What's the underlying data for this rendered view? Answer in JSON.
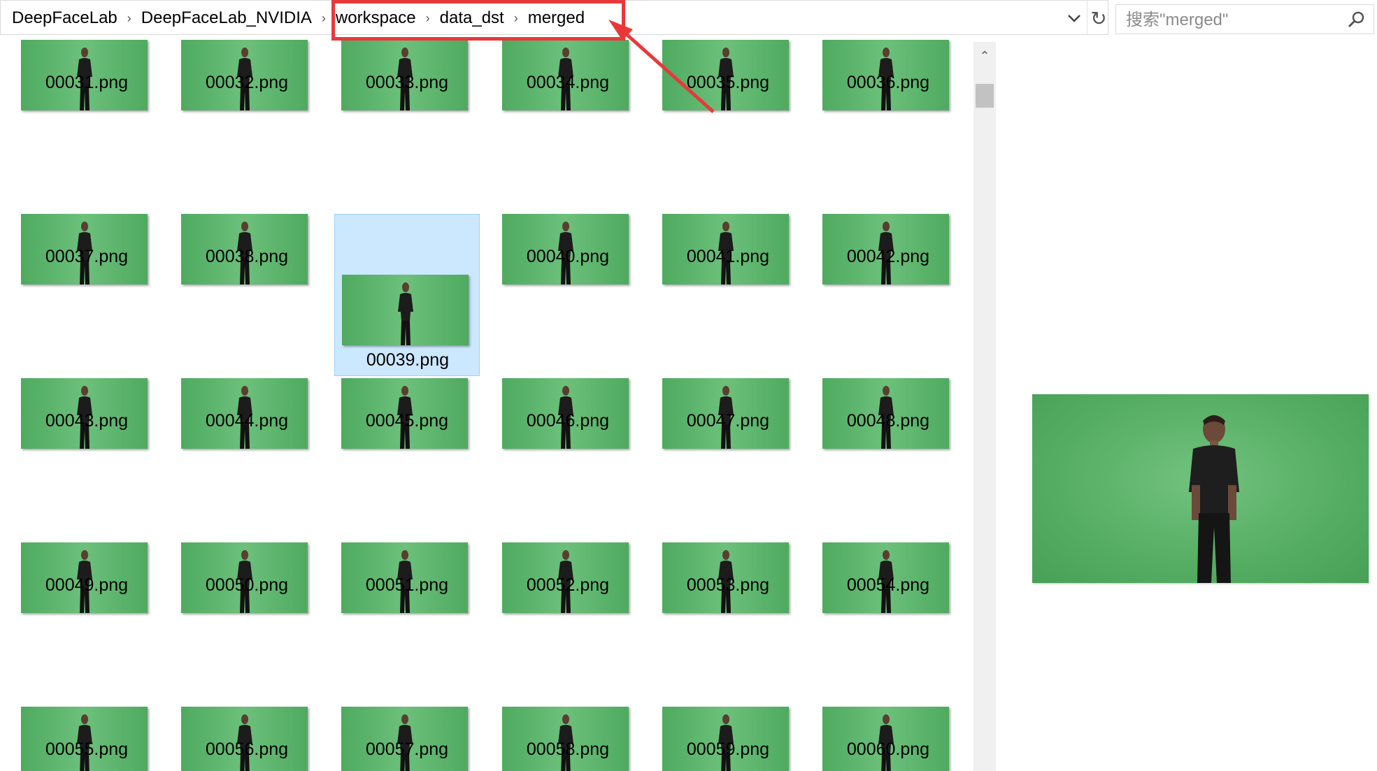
{
  "address_bar": {
    "crumbs": [
      "DeepFaceLab",
      "DeepFaceLab_NVIDIA",
      "workspace",
      "data_dst",
      "merged"
    ],
    "dropdown_icon": "chevron-down-icon",
    "refresh_icon": "refresh-icon"
  },
  "search": {
    "placeholder": "搜索\"merged\"",
    "icon": "search-icon"
  },
  "files": [
    "00031.png",
    "00032.png",
    "00033.png",
    "00034.png",
    "00035.png",
    "00036.png",
    "00037.png",
    "00038.png",
    "00039.png",
    "00040.png",
    "00041.png",
    "00042.png",
    "00043.png",
    "00044.png",
    "00045.png",
    "00046.png",
    "00047.png",
    "00048.png",
    "00049.png",
    "00050.png",
    "00051.png",
    "00052.png",
    "00053.png",
    "00054.png",
    "00055.png",
    "00056.png",
    "00057.png",
    "00058.png",
    "00059.png",
    "00060.png"
  ],
  "selected_file": "00039.png",
  "annotation_color": "#e8393a",
  "thumbnail_color": "#5fb56e"
}
